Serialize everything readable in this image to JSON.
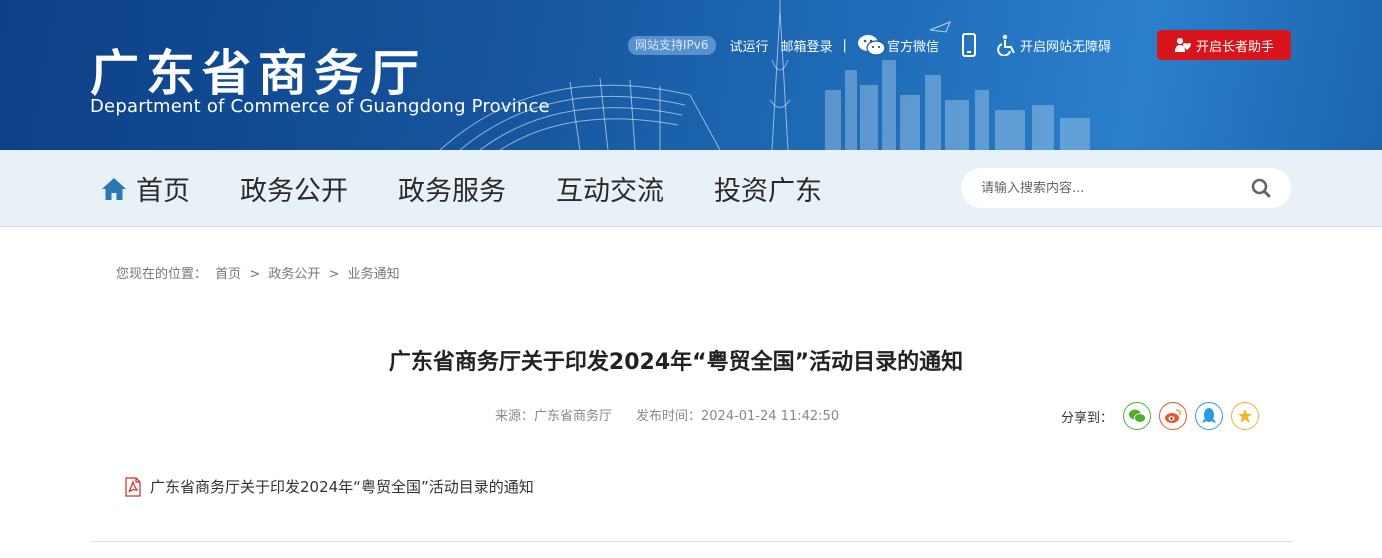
{
  "header": {
    "logo_cn": "广东省商务厅",
    "logo_en": "Department of Commerce of Guangdong Province",
    "ipv6_badge": "网站支持IPv6",
    "links": {
      "trial": "试运行",
      "mailbox": "邮箱登录",
      "separator": "|",
      "wechat": "官方微信",
      "accessibility": "开启网站无障碍",
      "elder_mode": "开启长者助手"
    },
    "icons": {
      "wechat": "wechat-icon",
      "mobile": "mobile-icon",
      "accessibility": "wheelchair-icon",
      "elder": "elder-icon"
    }
  },
  "nav": {
    "items": [
      {
        "label": "首页",
        "icon": "home-icon"
      },
      {
        "label": "政务公开"
      },
      {
        "label": "政务服务"
      },
      {
        "label": "互动交流"
      },
      {
        "label": "投资广东"
      }
    ],
    "search_placeholder": "请输入搜索内容...",
    "search_icon": "search-icon"
  },
  "breadcrumb": {
    "prefix": "您现在的位置：",
    "items": [
      "首页",
      "政务公开",
      "业务通知"
    ],
    "separator": ">"
  },
  "article": {
    "title": "广东省商务厅关于印发2024年“粤贸全国”活动目录的通知",
    "source": "来源：广东省商务厅",
    "publish_time": "发布时间：2024-01-24 11:42:50",
    "share_label": "分享到：",
    "share_targets": [
      {
        "name": "wechat",
        "icon": "wechat-share-icon",
        "color": "#4fae2e"
      },
      {
        "name": "weibo",
        "icon": "weibo-share-icon",
        "color": "#e5582c"
      },
      {
        "name": "qq",
        "icon": "qq-share-icon",
        "color": "#2b9be0"
      },
      {
        "name": "qzone",
        "icon": "qzone-share-icon",
        "color": "#f0b52a"
      }
    ],
    "attachment": "广东省商务厅关于印发2024年“粤贸全国”活动目录的通知",
    "attachment_icon": "pdf-icon"
  },
  "colors": {
    "banner": "#16569f",
    "nav_bg": "#e8f1f7",
    "elder_button": "#d8151c"
  }
}
